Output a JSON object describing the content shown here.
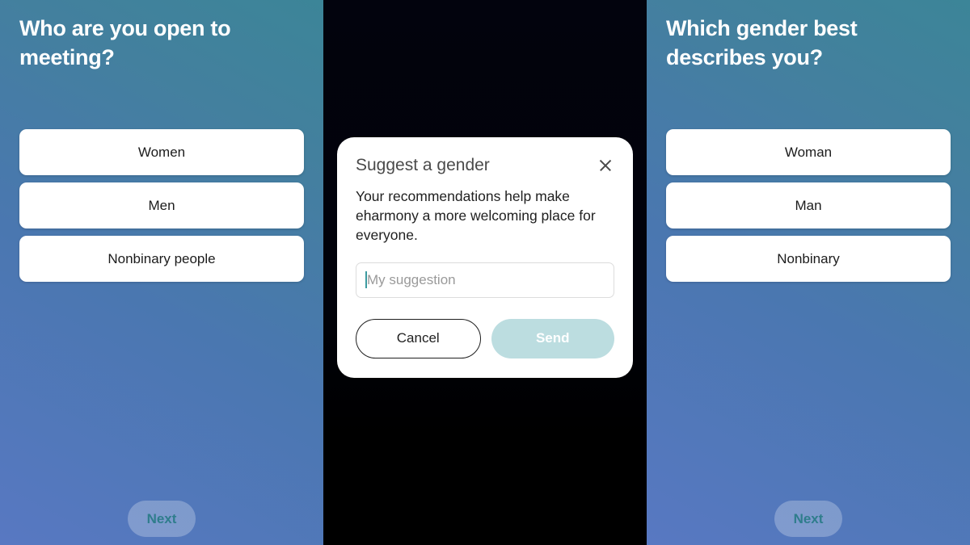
{
  "screens": {
    "left": {
      "headline": "Who are you open to meeting?",
      "options": [
        {
          "label": "Women"
        },
        {
          "label": "Men"
        },
        {
          "label": "Nonbinary people"
        }
      ],
      "next_label": "Next"
    },
    "middle": {
      "modal": {
        "title": "Suggest a gender",
        "close_icon": "close-icon",
        "body": "Your recommendations help make eharmony a more welcoming place for everyone.",
        "input": {
          "value": "",
          "placeholder": "My suggestion"
        },
        "cancel_label": "Cancel",
        "send_label": "Send"
      }
    },
    "right": {
      "headline": "Which gender best describes you?",
      "options": [
        {
          "label": "Woman"
        },
        {
          "label": "Man"
        },
        {
          "label": "Nonbinary"
        }
      ],
      "next_label": "Next"
    }
  },
  "colors": {
    "gradient_top": "#3c8598",
    "gradient_bottom": "#5878c2",
    "overlay": "#000000",
    "accent_teal": "#3d9ba0",
    "send_disabled": "#bcdde0",
    "next_text": "#2f7d8c",
    "option_bg": "#ffffff"
  }
}
